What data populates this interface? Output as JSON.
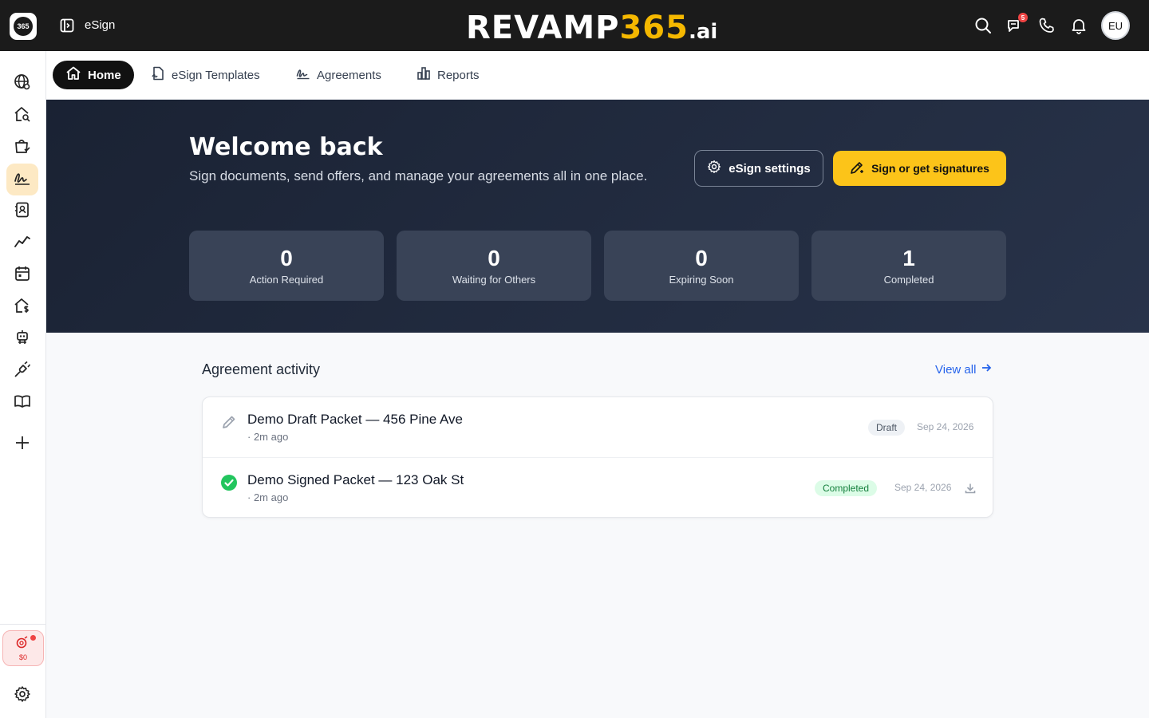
{
  "topbar": {
    "app_name": "eSign",
    "brand": {
      "prefix": "REVAMP",
      "number": "365",
      "suffix": ".ai"
    },
    "notifications_count": "5",
    "avatar_initials": "EU"
  },
  "sidebar": {
    "credits_value": "$0"
  },
  "tabs": [
    {
      "label": "Home"
    },
    {
      "label": "eSign Templates"
    },
    {
      "label": "Agreements"
    },
    {
      "label": "Reports"
    }
  ],
  "hero": {
    "title": "Welcome back",
    "subtitle": "Sign documents, send offers, and manage your agreements all in one place.",
    "settings_label": "eSign settings",
    "sign_label": "Sign or get signatures"
  },
  "stats": [
    {
      "value": "0",
      "label": "Action Required"
    },
    {
      "value": "0",
      "label": "Waiting for Others"
    },
    {
      "value": "0",
      "label": "Expiring Soon"
    },
    {
      "value": "1",
      "label": "Completed"
    }
  ],
  "activity": {
    "title": "Agreement activity",
    "view_all": "View all",
    "rows": [
      {
        "name": "Demo Draft Packet — 456 Pine Ave",
        "time": "· 2m ago",
        "status": "Draft",
        "date": "Sep 24, 2026"
      },
      {
        "name": "Demo Signed Packet — 123 Oak St",
        "time": "· 2m ago",
        "status": "Completed",
        "date": "Sep 24, 2026"
      }
    ]
  },
  "colors": {
    "accent_yellow": "#fcc419",
    "hero_bg": "#1a2233",
    "link_blue": "#2563eb",
    "success_green": "#22c55e"
  }
}
